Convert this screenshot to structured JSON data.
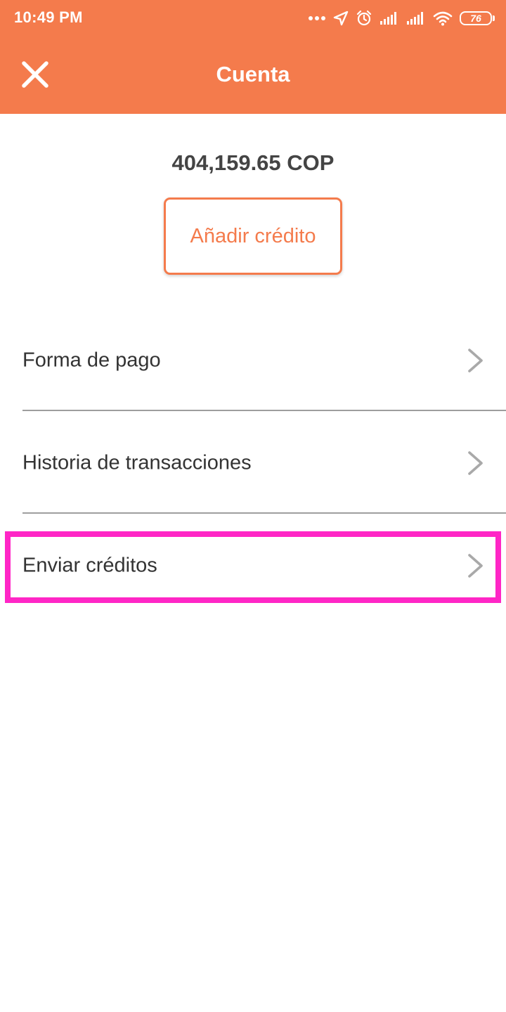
{
  "status_bar": {
    "time": "10:49 PM",
    "battery_level": "76",
    "icons": [
      "more-dots-icon",
      "location-arrow-icon",
      "alarm-icon",
      "signal-icon",
      "signal-icon",
      "wifi-icon",
      "battery-icon"
    ]
  },
  "header": {
    "title": "Cuenta",
    "close_icon": "close-icon",
    "color": "#F47B4C"
  },
  "account": {
    "balance": "404,159.65 COP",
    "add_credit_label": "Añadir crédito"
  },
  "menu": {
    "items": [
      {
        "label": "Forma de pago",
        "icon": "chevron-right-icon"
      },
      {
        "label": "Historia de transacciones",
        "icon": "chevron-right-icon"
      },
      {
        "label": "Enviar créditos",
        "icon": "chevron-right-icon"
      }
    ]
  },
  "highlight": {
    "target": "Enviar créditos",
    "color": "#FF26C6"
  }
}
